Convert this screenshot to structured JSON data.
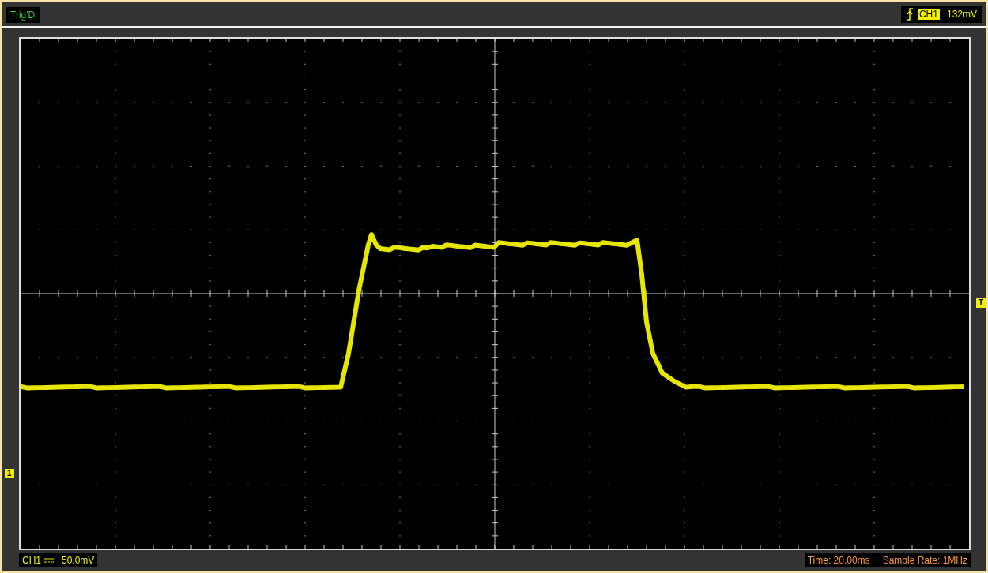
{
  "status": {
    "label": "Trig'D"
  },
  "trigger": {
    "channel": "CH1",
    "level": "132mV"
  },
  "markers": [
    {
      "kind": "channel",
      "label": "1"
    },
    {
      "kind": "trigger",
      "label": "T"
    }
  ],
  "channel_info": {
    "channel": "CH1",
    "scale": "50.0mV"
  },
  "timebase": "Time: 20.00ms",
  "sample_rate": "Sample Rate: 1MHz"
}
